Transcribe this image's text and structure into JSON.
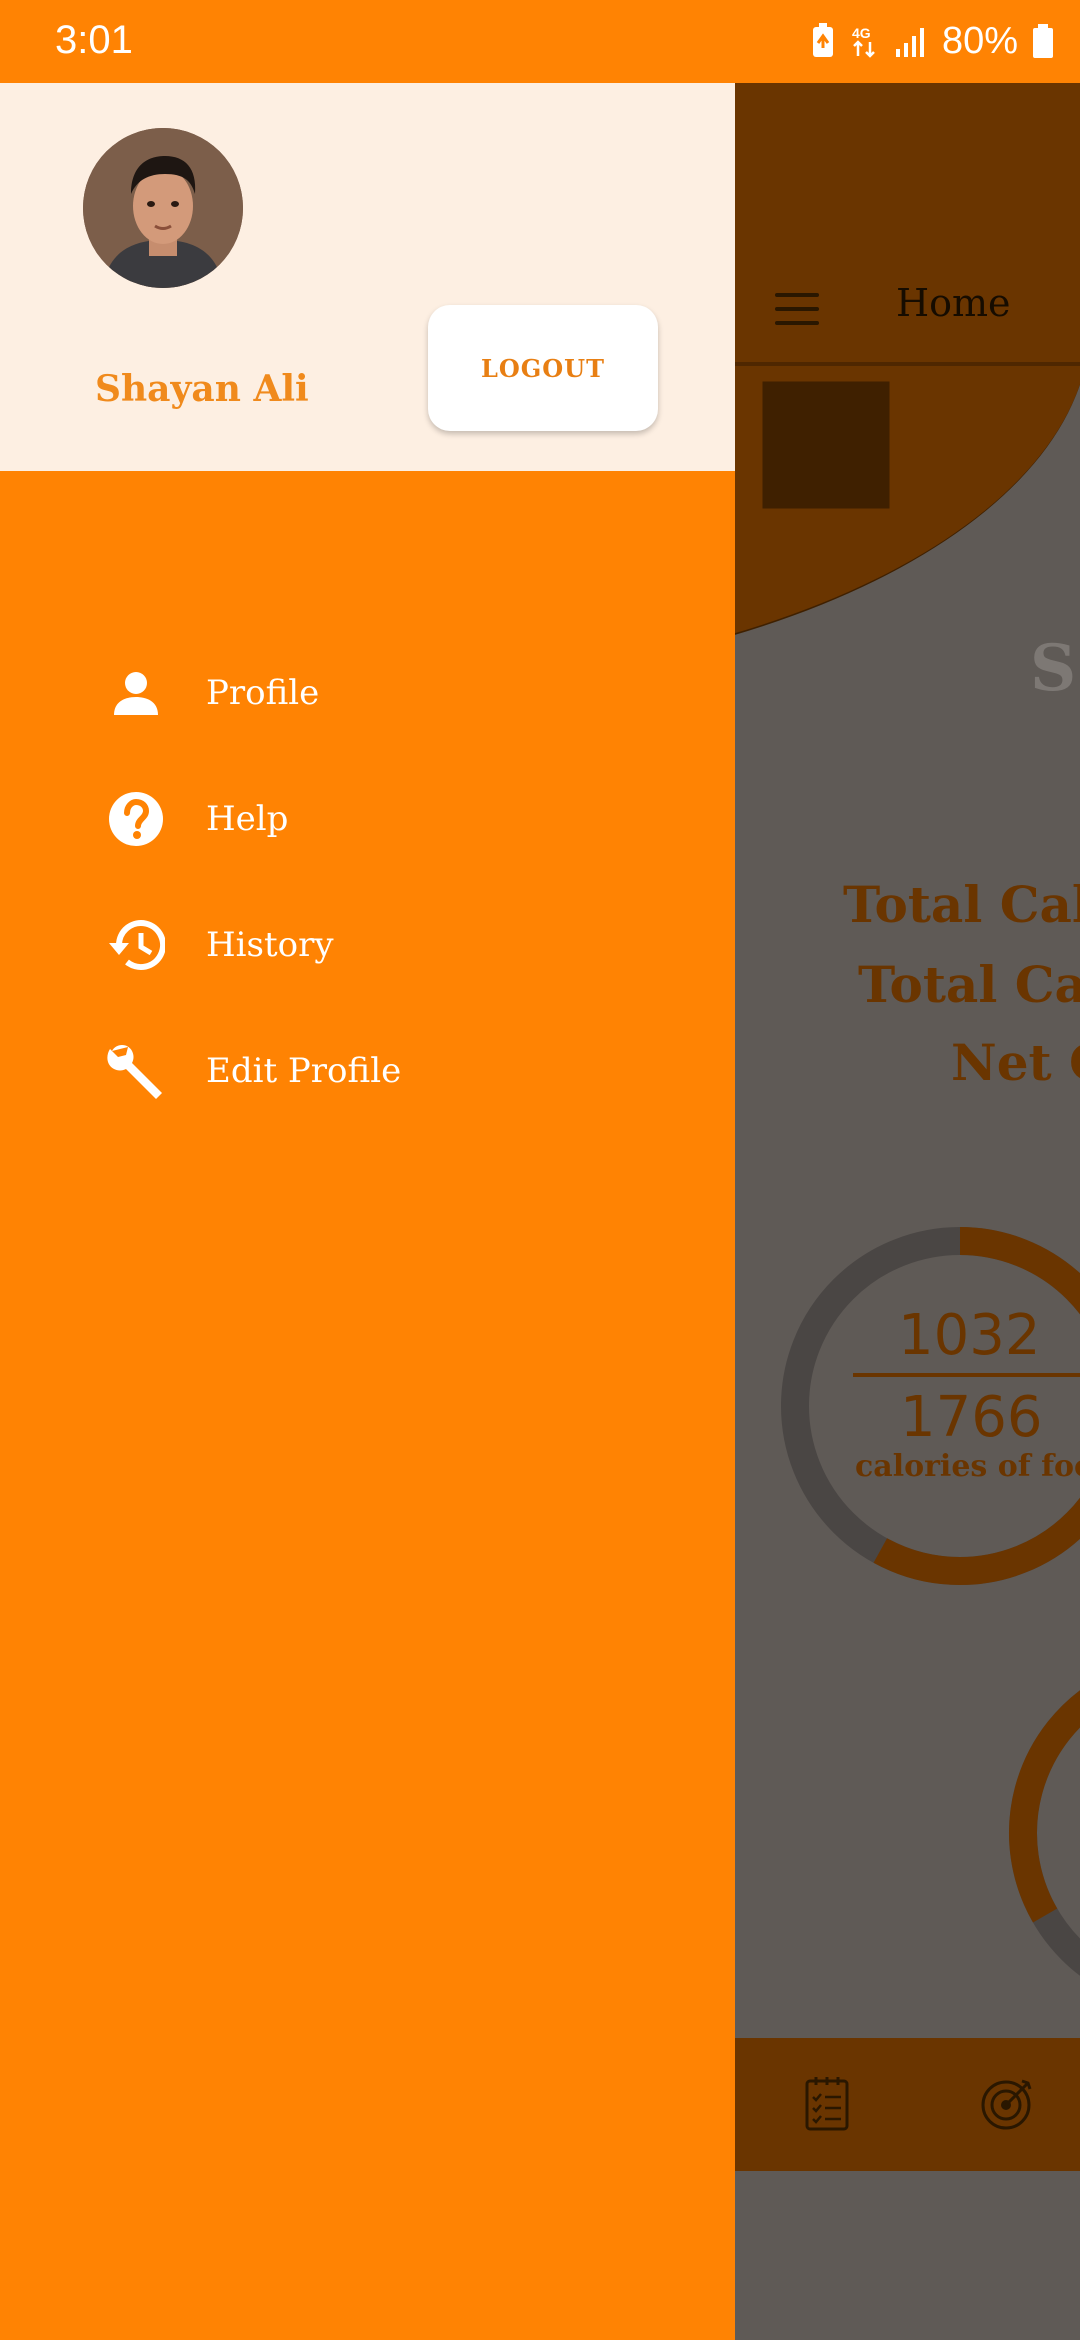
{
  "status_bar": {
    "time": "3:01",
    "network": "4G",
    "battery": "80%"
  },
  "drawer": {
    "user_name": "Shayan Ali",
    "logout_label": "LOGOUT",
    "items": [
      {
        "label": "Profile",
        "icon": "person-icon"
      },
      {
        "label": "Help",
        "icon": "help-icon"
      },
      {
        "label": "History",
        "icon": "history-icon"
      },
      {
        "label": "Edit Profile",
        "icon": "wrench-icon"
      }
    ]
  },
  "background_screen": {
    "title": "Home",
    "ghost_text": "S",
    "total_line_1": "Total Calo",
    "total_line_2": "Total Calo",
    "net_line": "Net C",
    "consumed_value": "1032",
    "goal_value": "1766",
    "calories_label": "calories of food consumed",
    "consumed_fraction": 0.58
  },
  "colors": {
    "drawer": "#ff8303",
    "drawer_header": "#fdefe2",
    "bg_dim": "#5f5a56",
    "bg_accent": "#6a3500"
  }
}
